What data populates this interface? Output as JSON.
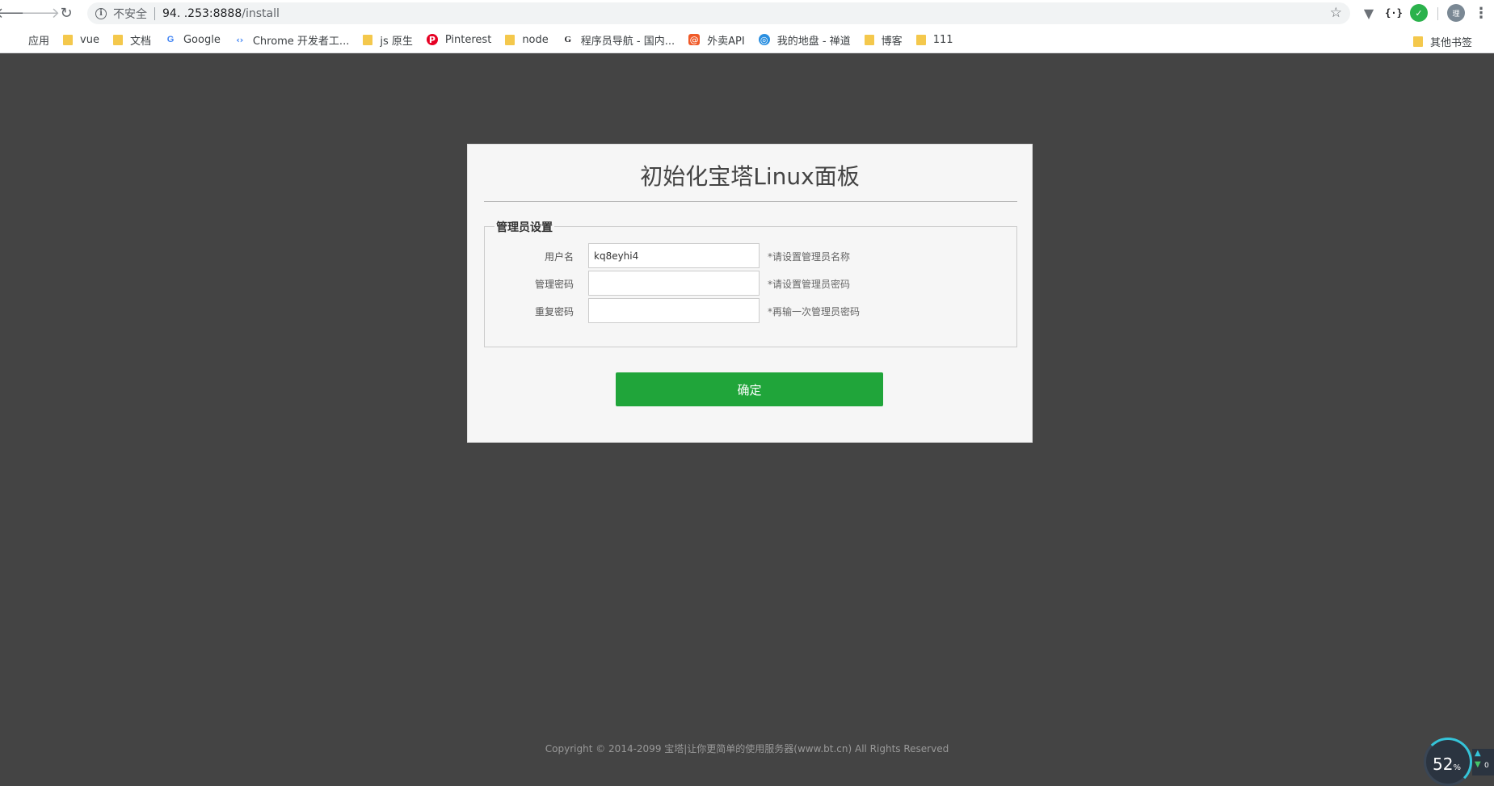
{
  "browser": {
    "security_label": "不安全",
    "url_host": "94.        .253:8888",
    "url_path": "/install",
    "ext_braces": "{·}",
    "ext_avatar": "理",
    "ext_green": "✓",
    "bookmarks": [
      {
        "label": "应用",
        "icon": "apps-grid-icon"
      },
      {
        "label": "vue",
        "icon": "folder-icon"
      },
      {
        "label": "文档",
        "icon": "folder-icon"
      },
      {
        "label": "Google",
        "icon": "google-icon"
      },
      {
        "label": "Chrome 开发者工...",
        "icon": "chrome-dev-icon"
      },
      {
        "label": "js 原生",
        "icon": "folder-icon"
      },
      {
        "label": "Pinterest",
        "icon": "pinterest-icon"
      },
      {
        "label": "node",
        "icon": "folder-icon"
      },
      {
        "label": "程序员导航 - 国内...",
        "icon": "g-site-icon"
      },
      {
        "label": "外卖API",
        "icon": "red-app-icon"
      },
      {
        "label": "我的地盘 - 禅道",
        "icon": "zentao-icon"
      },
      {
        "label": "博客",
        "icon": "folder-icon"
      },
      {
        "label": "111",
        "icon": "folder-icon"
      }
    ],
    "other_bookmarks": "其他书签"
  },
  "form": {
    "title": "初始化宝塔Linux面板",
    "legend": "管理员设置",
    "username_label": "用户名",
    "username_value": "kq8eyhi4",
    "username_hint": "*请设置管理员名称",
    "password_label": "管理密码",
    "password_value": "",
    "password_hint": "*请设置管理员密码",
    "repeat_label": "重复密码",
    "repeat_value": "",
    "repeat_hint": "*再输一次管理员密码",
    "submit_label": "确定"
  },
  "footer": {
    "copyright": "Copyright © 2014-2099 宝塔|让你更简单的使用服务器(www.bt.cn) All Rights Reserved"
  },
  "speed_widget": {
    "percent": "52",
    "unit": "%",
    "download_count": "0"
  },
  "colors": {
    "page_bg": "#444444",
    "button": "#20a53a"
  }
}
